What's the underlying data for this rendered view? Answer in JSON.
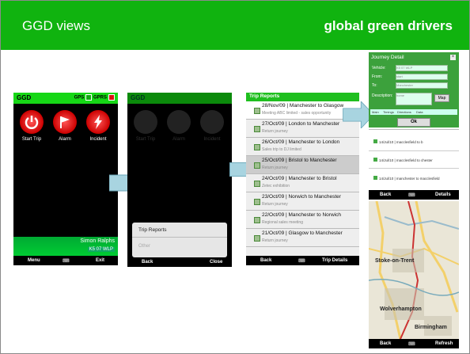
{
  "header": {
    "left_title": "GGD views",
    "right_title": "global green drivers"
  },
  "colors": {
    "brand_green": "#10b30f",
    "phone_header_green": "#16d716"
  },
  "phone1": {
    "title": "GGD",
    "gps1": "GPS",
    "gps2": "GPRS",
    "icons": [
      {
        "label": "Start Trip",
        "icon": "power-icon"
      },
      {
        "label": "Alarm",
        "icon": "flag-icon"
      },
      {
        "label": "Incident",
        "icon": "lightning-icon"
      }
    ],
    "user_name": "Simon Ralphs",
    "vehicle": "K5 07 WLP",
    "menu": "Menu",
    "exit": "Exit"
  },
  "phone2": {
    "title": "GGD",
    "icons": [
      {
        "label": "Start Trip"
      },
      {
        "label": "Alarm"
      },
      {
        "label": "Incident"
      }
    ],
    "popup_title": "Trip Reports",
    "popup_other": "Other",
    "back": "Back",
    "close": "Close"
  },
  "phone3": {
    "title": "Trip Reports",
    "rows": [
      {
        "title": "28/Nov/09 | Manchester to Glasgow",
        "sub": "Meeting ABC limited - sales opportunity"
      },
      {
        "title": "27/Oct/09 | London to Manchester",
        "sub": "Return journey"
      },
      {
        "title": "26/Oct/09 | Manchester to London",
        "sub": "Sales trip to DJ limited"
      },
      {
        "title": "25/Oct/09 | Bristol to Manchester",
        "sub": "Return journey"
      },
      {
        "title": "24/Oct/09 | Manchester to Bristol",
        "sub": "Zetec exhibition"
      },
      {
        "title": "23/Oct/09 | Norwich to Manchester",
        "sub": "Return journey"
      },
      {
        "title": "22/Oct/09 | Manchester to Norwich",
        "sub": "Regional sales meeting"
      },
      {
        "title": "21/Oct/09 | Glasgow to Manchester",
        "sub": "Return journey"
      }
    ],
    "back": "Back",
    "trip_details": "Trip Details"
  },
  "phone4": {
    "title": "Journey Detail",
    "fields": [
      {
        "label": "Vehicle:",
        "value": "K5 07 WLP"
      },
      {
        "label": "From:",
        "value": "start"
      },
      {
        "label": "To:",
        "value": "Manchester"
      },
      {
        "label": "Description:",
        "value": "home"
      }
    ],
    "map_btn": "Map",
    "tabs": [
      "Main",
      "Timings",
      "Directions",
      "Data"
    ],
    "ok": "Ok",
    "rows": [
      "14/Jul/10 | macclesfield to b",
      "14/Jul/10 | macclesfield to chester",
      "14/Jul/10 | manchester to macclesfield"
    ],
    "back": "Back",
    "details": "Details"
  },
  "phone5": {
    "labels": [
      "Stoke-on-Trent",
      "Wolverhampton",
      "Birmingham"
    ],
    "back": "Back",
    "refresh": "Refresh"
  }
}
